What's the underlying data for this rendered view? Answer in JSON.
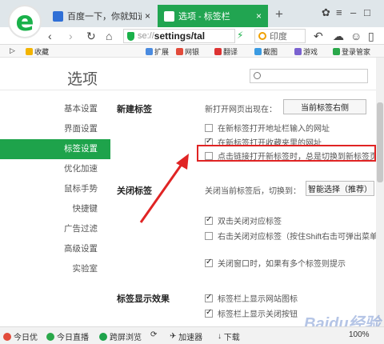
{
  "tabs": [
    {
      "label": "百度一下，你就知道",
      "active": false
    },
    {
      "label": "选项 - 标签栏",
      "active": true
    }
  ],
  "nav": {
    "url_prefix": "se://",
    "url_main": "settings/tal",
    "search_engine": "印度"
  },
  "bookmarks": [
    "收藏",
    "扩展",
    "网银",
    "翻译",
    "截图",
    "游戏",
    "登录管家"
  ],
  "settings": {
    "title": "选项",
    "search_placeholder": "",
    "sidebar": [
      {
        "label": "基本设置",
        "active": false
      },
      {
        "label": "界面设置",
        "active": false
      },
      {
        "label": "标签设置",
        "active": true
      },
      {
        "label": "优化加速",
        "active": false
      },
      {
        "label": "鼠标手势",
        "active": false
      },
      {
        "label": "快捷键",
        "active": false
      },
      {
        "label": "广告过滤",
        "active": false
      },
      {
        "label": "高级设置",
        "active": false
      },
      {
        "label": "实验室",
        "active": false
      }
    ],
    "new_tab": {
      "section": "新建标签",
      "open_pos_label": "新打开网页出现在：",
      "open_pos_value": "当前标签右侧",
      "options": [
        {
          "label": "在新标签打开地址栏输入的网址",
          "checked": false
        },
        {
          "label": "在新标签打开收藏夹里的网址",
          "checked": true
        },
        {
          "label": "点击链接打开新标签时，总是切换到新标签页",
          "checked": false
        }
      ]
    },
    "close_tab": {
      "section": "关闭标签",
      "switch_label": "关闭当前标签后，切换到：",
      "switch_value": "智能选择（推荐）",
      "options": [
        {
          "label": "双击关闭对应标签",
          "checked": true
        },
        {
          "label": "右击关闭对应标签（按住Shift右击可弹出菜单）",
          "checked": false
        },
        {
          "label": "关闭窗口时，如果有多个标签则提示",
          "checked": true
        }
      ]
    },
    "display": {
      "section": "标签显示效果",
      "options": [
        {
          "label": "标签栏上显示网站图标",
          "checked": true
        },
        {
          "label": "标签栏上显示关闭按钮",
          "checked": true
        }
      ]
    }
  },
  "status": {
    "items": [
      "今日优",
      "今日直播",
      "跨屏浏览",
      "加速器",
      "下载"
    ],
    "zoom": "100%"
  },
  "watermark": "Baidu经验",
  "colors": {
    "accent": "#1ea34b",
    "highlight": "#e02424"
  }
}
